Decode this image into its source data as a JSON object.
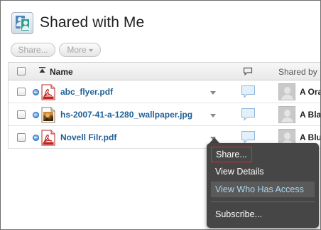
{
  "header": {
    "title": "Shared with Me",
    "app_icon": "shared-users-icon"
  },
  "toolbar": {
    "share_label": "Share...",
    "more_label": "More",
    "more_icon": "chevron-down-icon"
  },
  "table": {
    "columns": {
      "name": "Name",
      "comments_icon": "comment-icon",
      "shared_by": "Shared by"
    },
    "sort": "ascending",
    "rows": [
      {
        "file_name": "abc_flyer.pdf",
        "file_type_icon": "pdf-icon",
        "shared_by": "A Ora"
      },
      {
        "file_name": "hs-2007-41-a-1280_wallpaper.jpg",
        "file_type_icon": "image-file-icon",
        "shared_by": "A Bla"
      },
      {
        "file_name": "Novell Filr.pdf",
        "file_type_icon": "pdf-icon",
        "shared_by": "A Blu"
      }
    ]
  },
  "context_menu": {
    "items": [
      {
        "label": "Share...",
        "state": "focused"
      },
      {
        "label": "View Details",
        "state": "normal"
      },
      {
        "label": "View Who Has Access",
        "state": "hover"
      },
      {
        "label": "Subscribe...",
        "state": "normal"
      }
    ]
  },
  "colors": {
    "file_link": "#1f5f96",
    "menu_background": "#464646",
    "menu_hover_text": "#a9d7ee",
    "focus_outline": "#d92f2f"
  }
}
